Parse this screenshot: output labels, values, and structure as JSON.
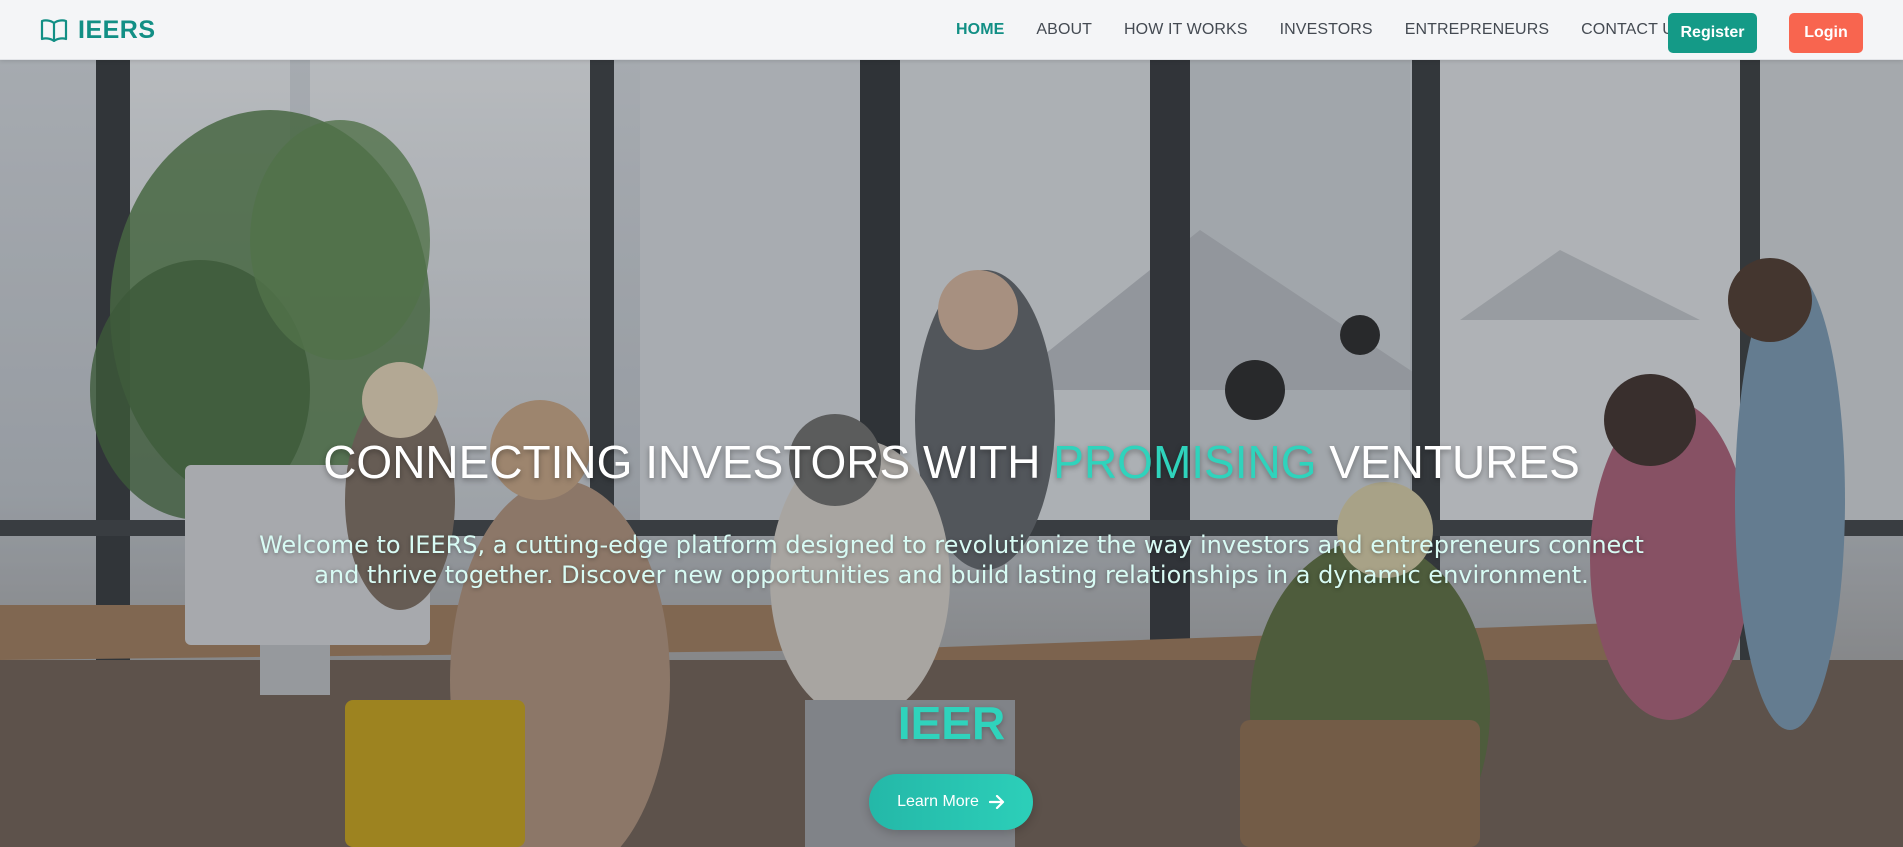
{
  "brand": {
    "name": "IEERS",
    "icon": "book-icon",
    "color": "#128f85"
  },
  "nav": {
    "items": [
      {
        "label": "HOME",
        "active": true
      },
      {
        "label": "ABOUT",
        "active": false
      },
      {
        "label": "HOW IT WORKS",
        "active": false
      },
      {
        "label": "INVESTORS",
        "active": false
      },
      {
        "label": "ENTREPRENEURS",
        "active": false
      },
      {
        "label": "CONTACT US",
        "active": false
      }
    ],
    "register_label": "Register",
    "login_label": "Login"
  },
  "hero": {
    "title_prefix": "CONNECTING INVESTORS WITH ",
    "title_accent": "PROMISING",
    "title_suffix": " VENTURES",
    "subtitle": "Welcome to IEERS, a cutting-edge platform designed to revolutionize the way investors and entrepreneurs connect and thrive together. Discover new opportunities and build lasting relationships in a dynamic environment.",
    "typed_text": "IEER",
    "cta_label": "Learn More",
    "cta_icon": "arrow-right-icon",
    "background": "office-team-photo"
  },
  "colors": {
    "accent": "#2fd3bc",
    "primary": "#149a87",
    "login": "#f8654f",
    "nav_bg": "#f4f5f7"
  }
}
